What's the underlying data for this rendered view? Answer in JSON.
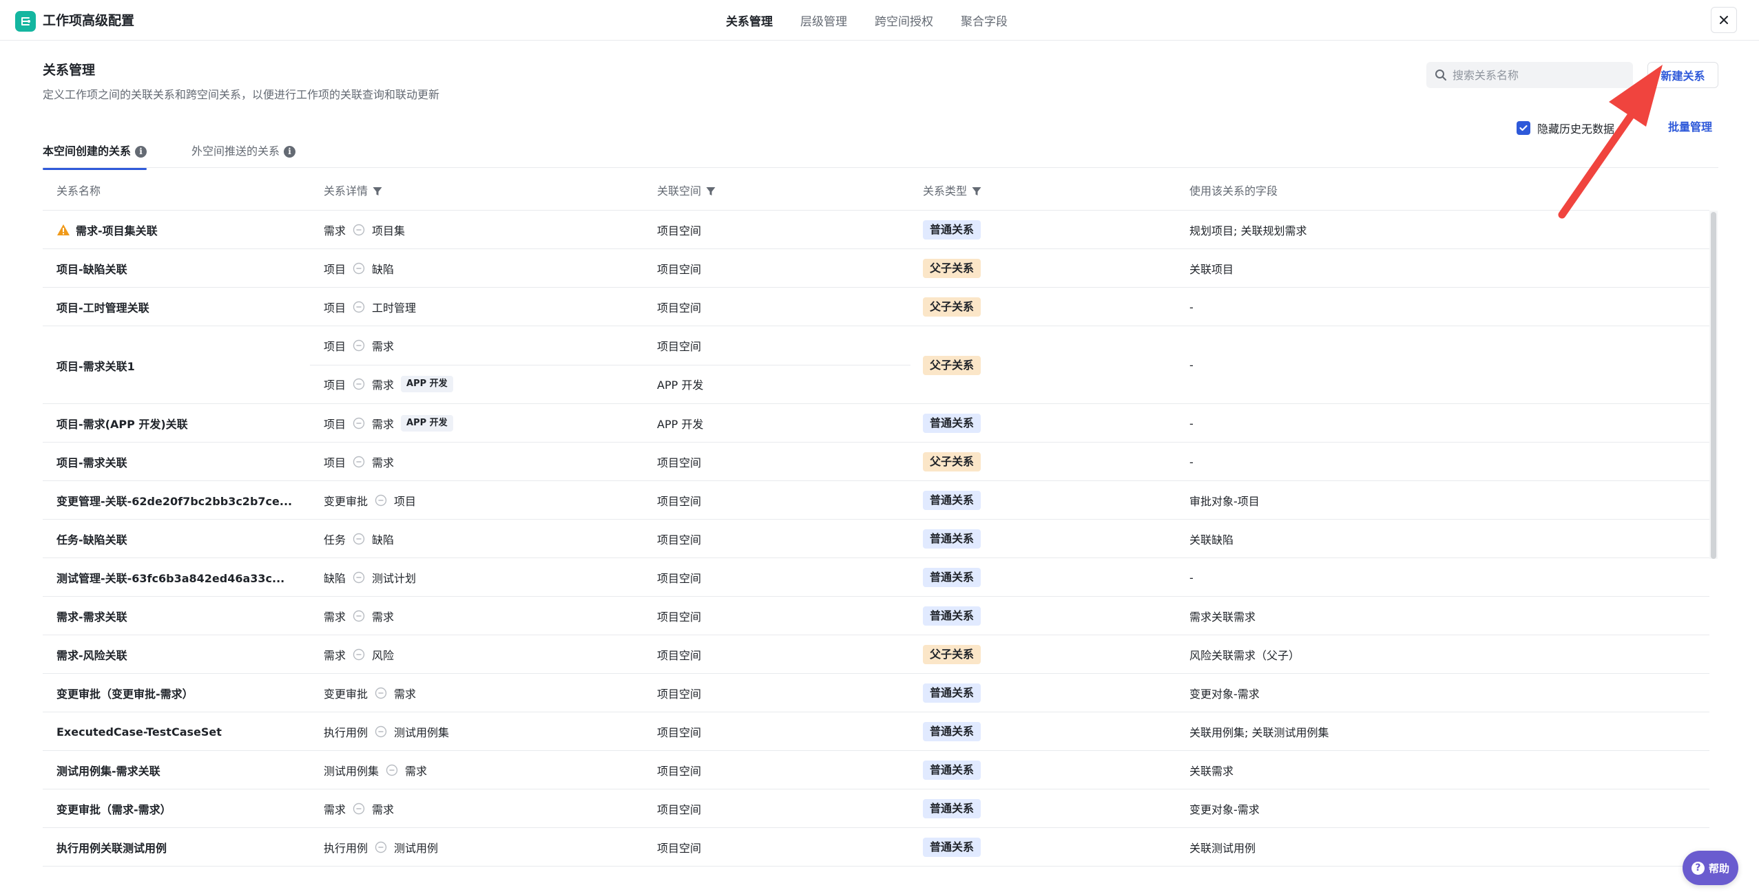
{
  "app": {
    "title": "工作项高级配置"
  },
  "top_tabs": [
    {
      "label": "关系管理",
      "active": true
    },
    {
      "label": "层级管理",
      "active": false
    },
    {
      "label": "跨空间授权",
      "active": false
    },
    {
      "label": "聚合字段",
      "active": false
    }
  ],
  "header": {
    "title": "关系管理",
    "description": "定义工作项之间的关联关系和跨空间关系，以便进行工作项的关联查询和联动更新",
    "search_placeholder": "搜索关系名称",
    "new_button": "新建关系",
    "hide_history_label": "隐藏历史无数据",
    "hide_history_checked": true,
    "batch_label": "批量管理"
  },
  "sub_tabs": [
    {
      "label": "本空间创建的关系",
      "active": true
    },
    {
      "label": "外空间推送的关系",
      "active": false
    }
  ],
  "table": {
    "columns": [
      "关系名称",
      "关系详情",
      "关联空间",
      "关系类型",
      "使用该关系的字段"
    ],
    "rows": [
      {
        "name": "需求-项目集关联",
        "warning": true,
        "details": [
          {
            "from": "需求",
            "to": "项目集",
            "tag": "",
            "space": "项目空间"
          }
        ],
        "type": "普通关系",
        "fields": "规划项目; 关联规划需求"
      },
      {
        "name": "项目-缺陷关联",
        "details": [
          {
            "from": "项目",
            "to": "缺陷",
            "tag": "",
            "space": "项目空间"
          }
        ],
        "type": "父子关系",
        "fields": "关联项目"
      },
      {
        "name": "项目-工时管理关联",
        "details": [
          {
            "from": "项目",
            "to": "工时管理",
            "tag": "",
            "space": "项目空间"
          }
        ],
        "type": "父子关系",
        "fields": "-"
      },
      {
        "name": "项目-需求关联1",
        "details": [
          {
            "from": "项目",
            "to": "需求",
            "tag": "",
            "space": "项目空间"
          },
          {
            "from": "项目",
            "to": "需求",
            "tag": "APP 开发",
            "space": "APP 开发"
          }
        ],
        "type": "父子关系",
        "fields": "-"
      },
      {
        "name": "项目-需求(APP 开发)关联",
        "details": [
          {
            "from": "项目",
            "to": "需求",
            "tag": "APP 开发",
            "space": "APP 开发"
          }
        ],
        "type": "普通关系",
        "fields": "-"
      },
      {
        "name": "项目-需求关联",
        "details": [
          {
            "from": "项目",
            "to": "需求",
            "tag": "",
            "space": "项目空间"
          }
        ],
        "type": "父子关系",
        "fields": "-"
      },
      {
        "name": "变更管理-关联-62de20f7bc2bb3c2b7ce...",
        "details": [
          {
            "from": "变更审批",
            "to": "项目",
            "tag": "",
            "space": "项目空间"
          }
        ],
        "type": "普通关系",
        "fields": "审批对象-项目"
      },
      {
        "name": "任务-缺陷关联",
        "details": [
          {
            "from": "任务",
            "to": "缺陷",
            "tag": "",
            "space": "项目空间"
          }
        ],
        "type": "普通关系",
        "fields": "关联缺陷"
      },
      {
        "name": "测试管理-关联-63fc6b3a842ed46a33c...",
        "details": [
          {
            "from": "缺陷",
            "to": "测试计划",
            "tag": "",
            "space": "项目空间"
          }
        ],
        "type": "普通关系",
        "fields": "-"
      },
      {
        "name": "需求-需求关联",
        "details": [
          {
            "from": "需求",
            "to": "需求",
            "tag": "",
            "space": "项目空间"
          }
        ],
        "type": "普通关系",
        "fields": "需求关联需求"
      },
      {
        "name": "需求-风险关联",
        "details": [
          {
            "from": "需求",
            "to": "风险",
            "tag": "",
            "space": "项目空间"
          }
        ],
        "type": "父子关系",
        "fields": "风险关联需求（父子）"
      },
      {
        "name": "变更审批（变更审批-需求）",
        "details": [
          {
            "from": "变更审批",
            "to": "需求",
            "tag": "",
            "space": "项目空间"
          }
        ],
        "type": "普通关系",
        "fields": "变更对象-需求"
      },
      {
        "name": "ExecutedCase-TestCaseSet",
        "details": [
          {
            "from": "执行用例",
            "to": "测试用例集",
            "tag": "",
            "space": "项目空间"
          }
        ],
        "type": "普通关系",
        "fields": "关联用例集; 关联测试用例集"
      },
      {
        "name": "测试用例集-需求关联",
        "details": [
          {
            "from": "测试用例集",
            "to": "需求",
            "tag": "",
            "space": "项目空间"
          }
        ],
        "type": "普通关系",
        "fields": "关联需求"
      },
      {
        "name": "变更审批（需求-需求）",
        "details": [
          {
            "from": "需求",
            "to": "需求",
            "tag": "",
            "space": "项目空间"
          }
        ],
        "type": "普通关系",
        "fields": "变更对象-需求"
      },
      {
        "name": "执行用例关联测试用例",
        "details": [
          {
            "from": "执行用例",
            "to": "测试用例",
            "tag": "",
            "space": "项目空间"
          }
        ],
        "type": "普通关系",
        "fields": "关联测试用例"
      }
    ]
  },
  "help": {
    "label": "帮助"
  },
  "colors": {
    "accent": "#2e59d9",
    "logo": "#14b6a0",
    "normal_badge": "#e1eaff",
    "parent_badge": "#fbe6c8",
    "arrow": "#f0443e",
    "help": "#6a5ccf"
  }
}
